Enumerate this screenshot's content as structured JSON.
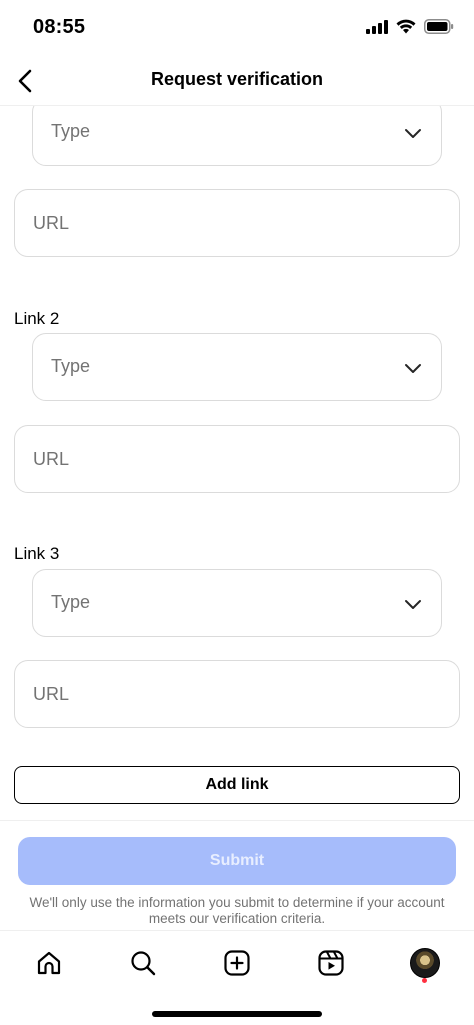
{
  "status_bar": {
    "time": "08:55",
    "icons": [
      "cellular-signal-icon",
      "wifi-icon",
      "battery-icon"
    ]
  },
  "header": {
    "title": "Request verification",
    "back_icon": "chevron-left-icon"
  },
  "links": [
    {
      "label": "",
      "type_placeholder": "Type",
      "url_placeholder": "URL"
    },
    {
      "label": "Link 2",
      "type_placeholder": "Type",
      "url_placeholder": "URL"
    },
    {
      "label": "Link 3",
      "type_placeholder": "Type",
      "url_placeholder": "URL"
    }
  ],
  "add_link_label": "Add link",
  "submit": {
    "label": "Submit",
    "enabled": false,
    "color": "#a6bcfb"
  },
  "disclaimer": "We'll only use the information you submit to determine if your account meets our verification criteria.",
  "tab_bar": {
    "items": [
      "home-icon",
      "search-icon",
      "create-icon",
      "reels-icon",
      "profile-avatar"
    ],
    "notification_dot_color": "#ff3040"
  }
}
